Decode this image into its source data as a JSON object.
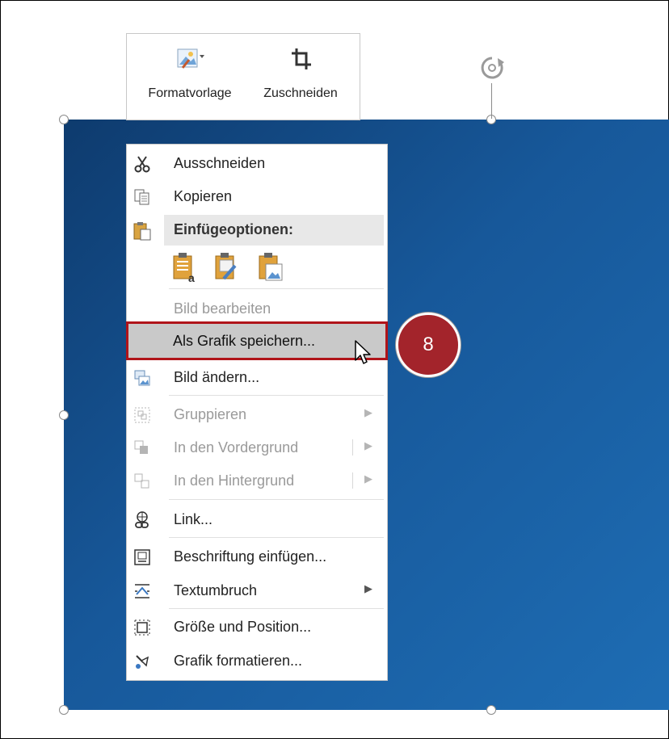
{
  "minibar": {
    "style_label": "Formatvorlage",
    "crop_label": "Zuschneiden"
  },
  "menu": {
    "cut": "Ausschneiden",
    "copy": "Kopieren",
    "paste_options_header": "Einfügeoptionen:",
    "edit_picture": "Bild bearbeiten",
    "save_as_picture": "Als Grafik speichern...",
    "change_picture": "Bild ändern...",
    "group": "Gruppieren",
    "bring_to_front": "In den Vordergrund",
    "send_to_back": "In den Hintergrund",
    "link": "Link...",
    "insert_caption": "Beschriftung einfügen...",
    "wrap_text": "Textumbruch",
    "size_position": "Größe und Position...",
    "format_picture": "Grafik formatieren..."
  },
  "step_badge": "8",
  "colors": {
    "picture_dark": "#0e3b6e",
    "picture_light": "#1e6db4",
    "highlight_border": "#b0141a",
    "badge": "#a3242b"
  }
}
